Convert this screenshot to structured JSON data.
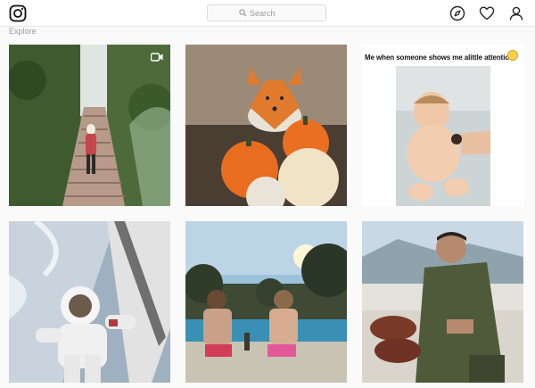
{
  "header": {
    "logo_icon": "instagram-logo-icon",
    "search_placeholder": "Search",
    "nav_icons": [
      "compass-icon",
      "heart-icon",
      "profile-icon"
    ]
  },
  "page": {
    "title": "Explore"
  },
  "grid": {
    "tiles": [
      {
        "subject": "woman on garden stairs",
        "video": true
      },
      {
        "subject": "fox on pumpkins",
        "video": false
      },
      {
        "subject": "baby meme",
        "video": false,
        "caption": "Me when someone shows me alittle attention"
      },
      {
        "subject": "astronaut spacewalk",
        "video": false
      },
      {
        "subject": "kids at pool",
        "video": false
      },
      {
        "subject": "man with shoes",
        "video": false
      }
    ]
  },
  "colors": {
    "background": "#fafafa",
    "topbar": "#ffffff",
    "border": "#e6e6e6",
    "muted_text": "#999999"
  }
}
